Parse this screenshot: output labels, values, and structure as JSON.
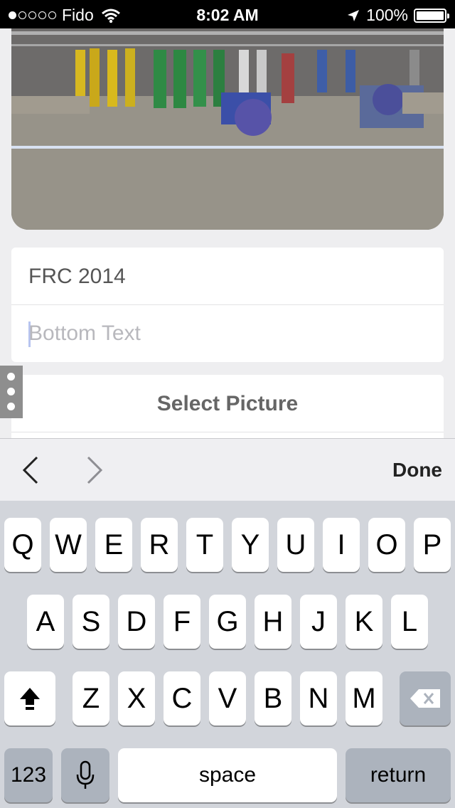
{
  "status_bar": {
    "carrier": "Fido",
    "time": "8:02 AM",
    "battery": "100%",
    "signal_dots_filled": 1,
    "signal_dots_total": 5
  },
  "form": {
    "top_text_value": "FRC 2014",
    "bottom_text_placeholder": "Bottom Text",
    "select_picture_label": "Select Picture"
  },
  "accessory_bar": {
    "done_label": "Done"
  },
  "keyboard": {
    "row1": [
      "Q",
      "W",
      "E",
      "R",
      "T",
      "Y",
      "U",
      "I",
      "O",
      "P"
    ],
    "row2": [
      "A",
      "S",
      "D",
      "F",
      "G",
      "H",
      "J",
      "K",
      "L"
    ],
    "row3": [
      "Z",
      "X",
      "C",
      "V",
      "B",
      "N",
      "M"
    ],
    "numbers_label": "123",
    "space_label": "space",
    "return_label": "return"
  },
  "icons": [
    "wifi-icon",
    "location-icon",
    "battery-icon",
    "chevron-left-icon",
    "chevron-right-icon",
    "shift-icon",
    "delete-icon",
    "microphone-icon"
  ]
}
